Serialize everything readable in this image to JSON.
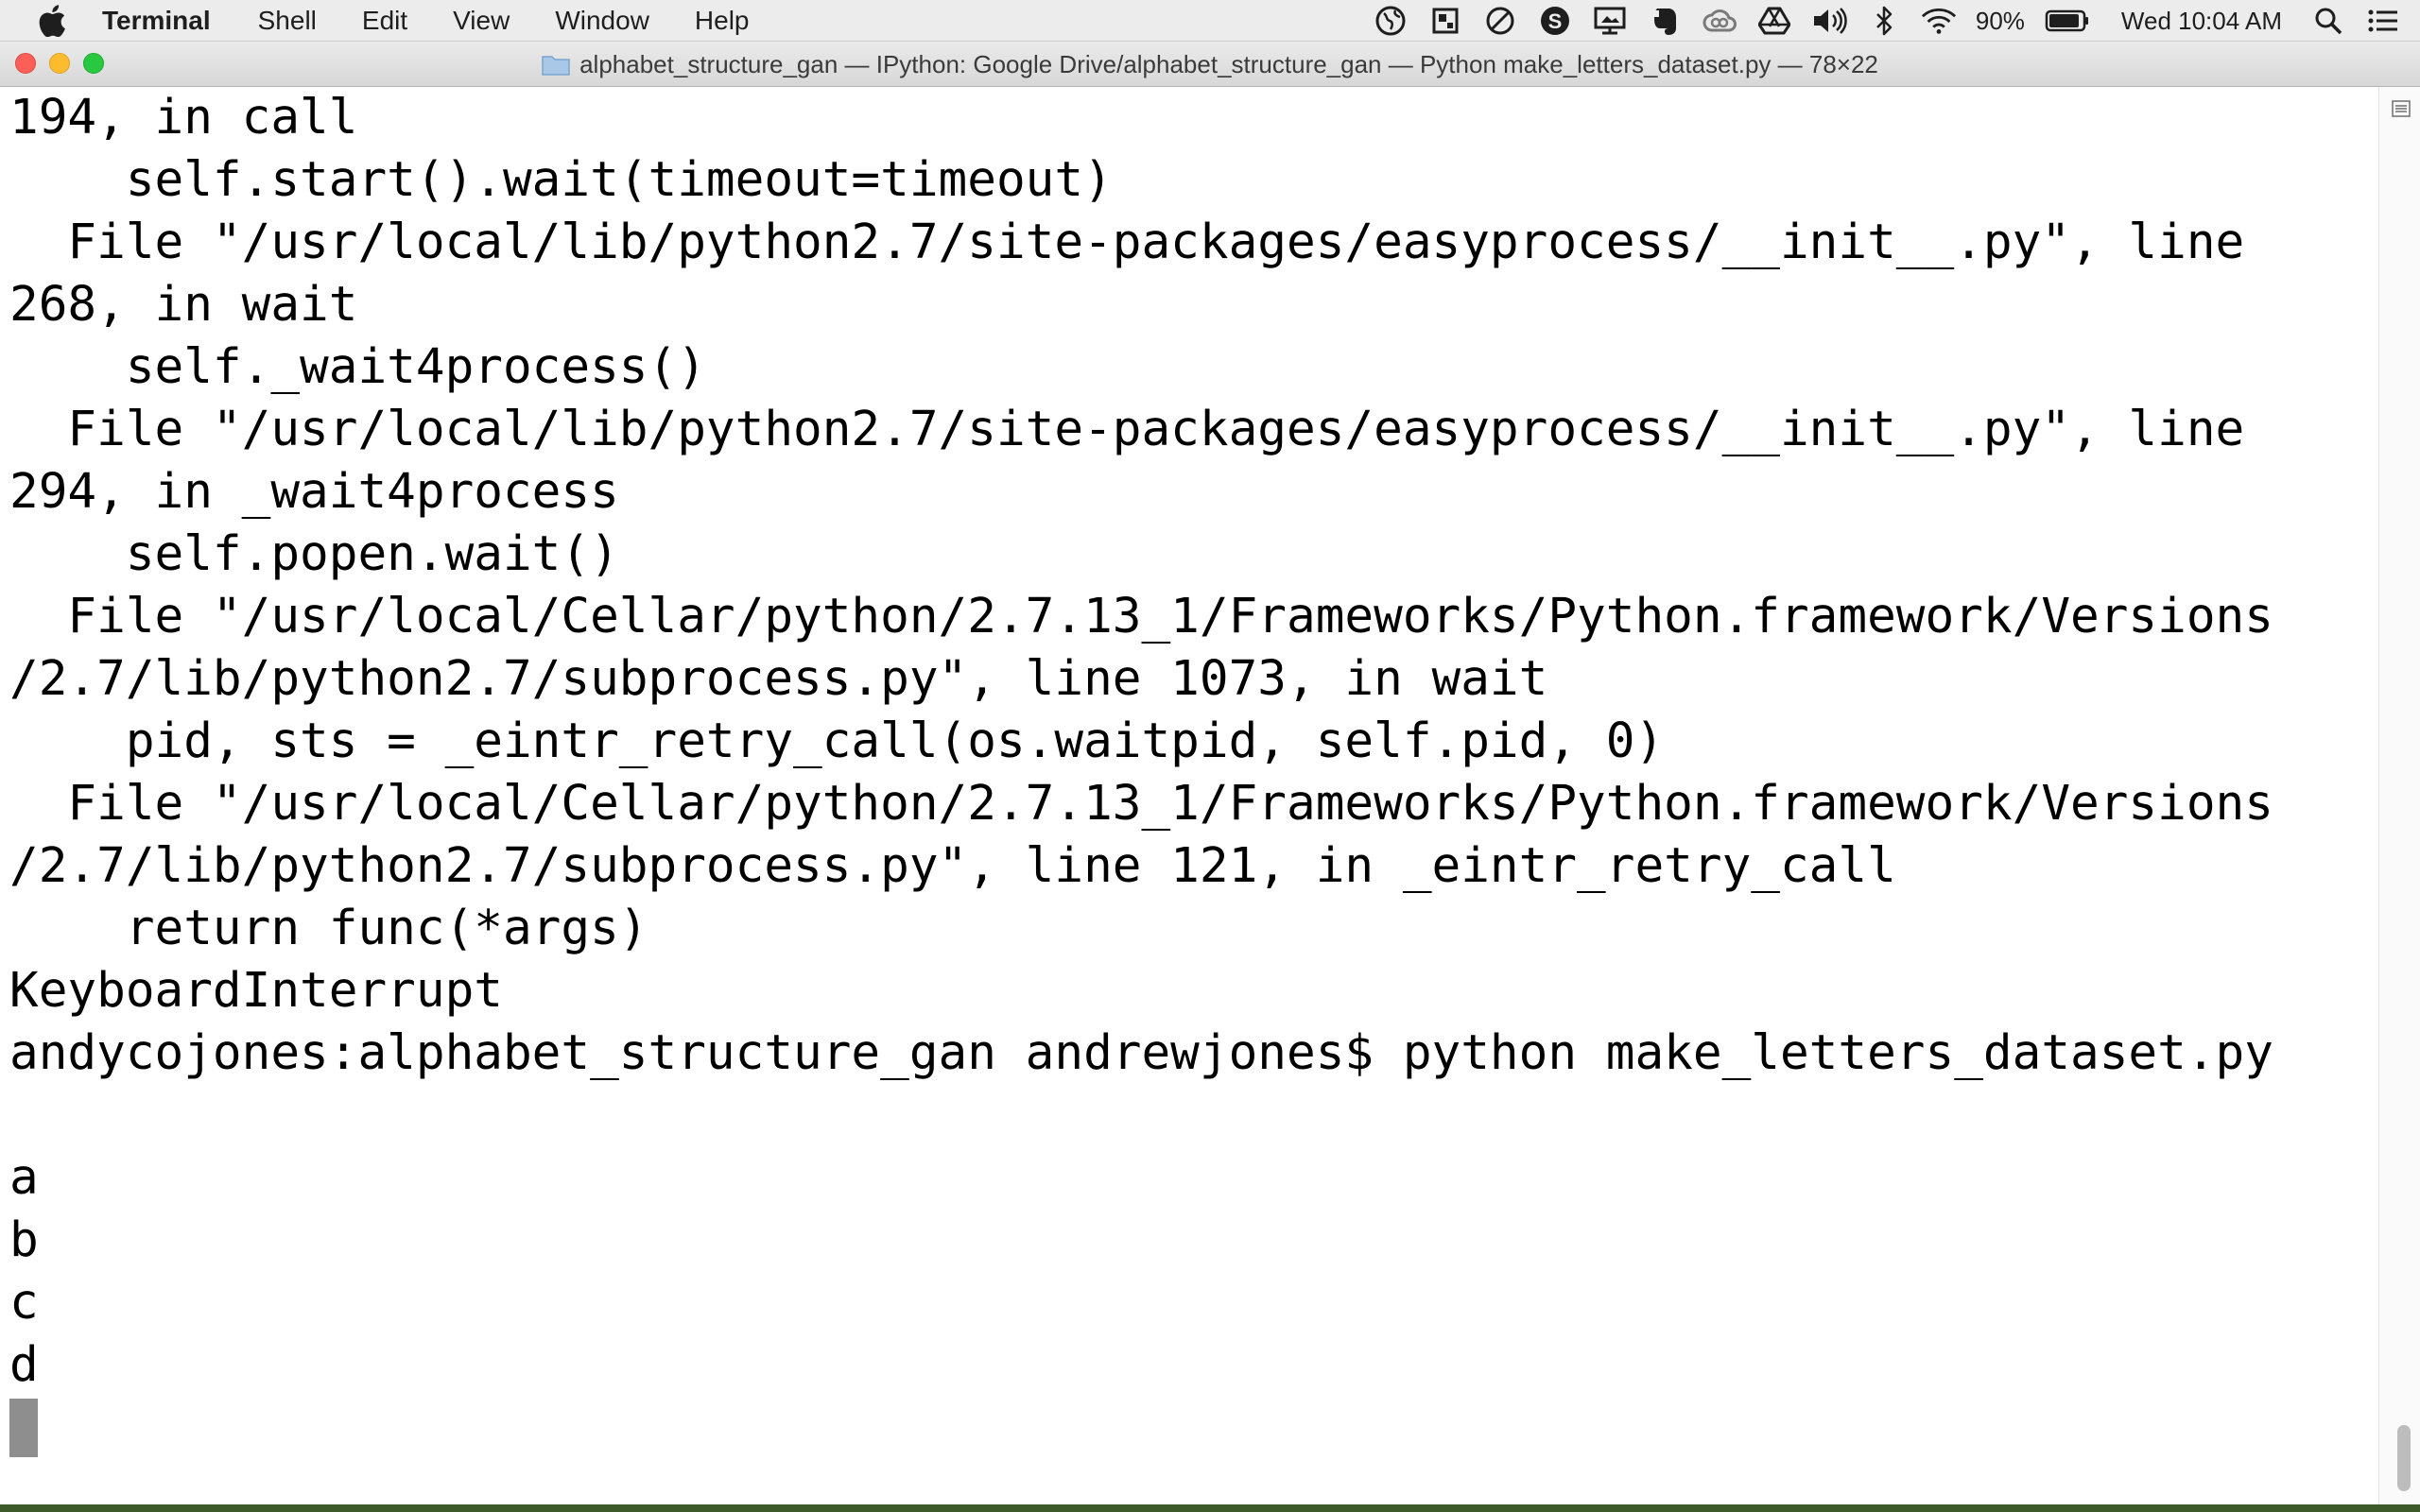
{
  "menubar": {
    "app_name": "Terminal",
    "items": [
      "Shell",
      "Edit",
      "View",
      "Window",
      "Help"
    ],
    "battery_percent": "90%",
    "clock": "Wed 10:04 AM",
    "status_icons": [
      "globe-icon",
      "screenshot-icon",
      "do-not-disturb-icon",
      "skype-icon",
      "display-icon",
      "evernote-icon",
      "creative-cloud-icon",
      "drive-icon",
      "volume-icon",
      "bluetooth-icon",
      "wifi-icon"
    ]
  },
  "window": {
    "title": "alphabet_structure_gan — IPython: Google Drive/alphabet_structure_gan — Python make_letters_dataset.py — 78×22"
  },
  "terminal": {
    "lines": [
      "194, in call",
      "    self.start().wait(timeout=timeout)",
      "  File \"/usr/local/lib/python2.7/site-packages/easyprocess/__init__.py\", line",
      "268, in wait",
      "    self._wait4process()",
      "  File \"/usr/local/lib/python2.7/site-packages/easyprocess/__init__.py\", line",
      "294, in _wait4process",
      "    self.popen.wait()",
      "  File \"/usr/local/Cellar/python/2.7.13_1/Frameworks/Python.framework/Versions",
      "/2.7/lib/python2.7/subprocess.py\", line 1073, in wait",
      "    pid, sts = _eintr_retry_call(os.waitpid, self.pid, 0)",
      "  File \"/usr/local/Cellar/python/2.7.13_1/Frameworks/Python.framework/Versions",
      "/2.7/lib/python2.7/subprocess.py\", line 121, in _eintr_retry_call",
      "    return func(*args)",
      "KeyboardInterrupt",
      "andycojones:alphabet_structure_gan andrewjones$ python make_letters_dataset.py",
      "",
      "a",
      "b",
      "c",
      "d"
    ]
  }
}
